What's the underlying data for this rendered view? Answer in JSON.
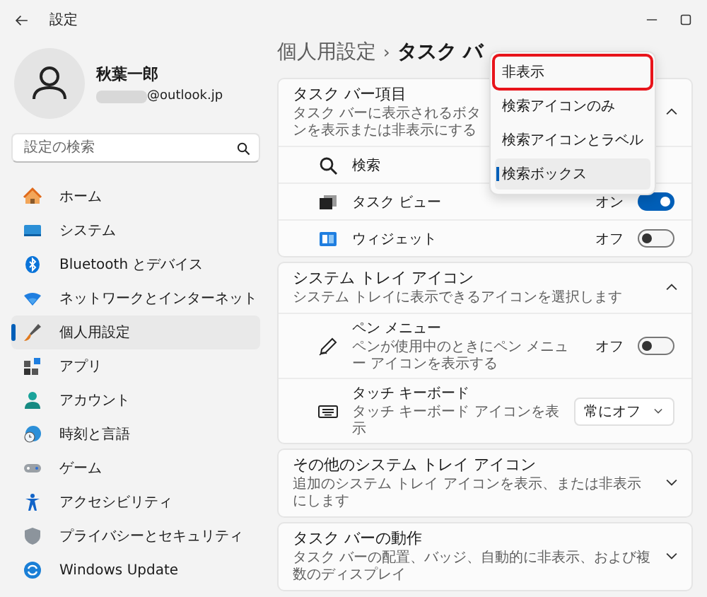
{
  "window": {
    "title": "設定"
  },
  "account": {
    "name": "秋葉一郎",
    "email": "@outlook.jp"
  },
  "search": {
    "placeholder": "設定の検索"
  },
  "sidebar": {
    "items": [
      {
        "label": "ホーム",
        "selected": false
      },
      {
        "label": "システム",
        "selected": false
      },
      {
        "label": "Bluetooth とデバイス",
        "selected": false
      },
      {
        "label": "ネットワークとインターネット",
        "selected": false
      },
      {
        "label": "個人用設定",
        "selected": true
      },
      {
        "label": "アプリ",
        "selected": false
      },
      {
        "label": "アカウント",
        "selected": false
      },
      {
        "label": "時刻と言語",
        "selected": false
      },
      {
        "label": "ゲーム",
        "selected": false
      },
      {
        "label": "アクセシビリティ",
        "selected": false
      },
      {
        "label": "プライバシーとセキュリティ",
        "selected": false
      },
      {
        "label": "Windows Update",
        "selected": false
      }
    ]
  },
  "breadcrumb": {
    "parent": "個人用設定",
    "separator": "›",
    "current": "タスク バ"
  },
  "sections": [
    {
      "title": "タスク バー項目",
      "description": "タスク バーに表示されるボタンを表示または非表示にする",
      "expanded": true,
      "items": [
        {
          "kind": "search",
          "label": "検索"
        },
        {
          "kind": "toggle",
          "label": "タスク ビュー",
          "state_text": "オン",
          "on": true
        },
        {
          "kind": "toggle",
          "label": "ウィジェット",
          "state_text": "オフ",
          "on": false
        }
      ]
    },
    {
      "title": "システム トレイ アイコン",
      "description": "システム トレイに表示できるアイコンを選択します",
      "expanded": true,
      "items": [
        {
          "kind": "toggle",
          "label": "ペン メニュー",
          "description": "ペンが使用中のときにペン メニュー アイコンを表示する",
          "state_text": "オフ",
          "on": false
        },
        {
          "kind": "select",
          "label": "タッチ キーボード",
          "description": "タッチ キーボード アイコンを表示",
          "value": "常にオフ"
        }
      ]
    },
    {
      "title": "その他のシステム トレイ アイコン",
      "description": "追加のシステム トレイ アイコンを表示、または非表示にします",
      "expanded": false
    },
    {
      "title": "タスク バーの動作",
      "description": "タスク バーの配置、バッジ、自動的に非表示、および複数のディスプレイ",
      "expanded": false
    }
  ],
  "menu": {
    "items": [
      {
        "label": "非表示",
        "selected": false,
        "highlighted": true
      },
      {
        "label": "検索アイコンのみ",
        "selected": false,
        "highlighted": false
      },
      {
        "label": "検索アイコンとラベル",
        "selected": false,
        "highlighted": false
      },
      {
        "label": "検索ボックス",
        "selected": true,
        "highlighted": false
      }
    ]
  }
}
